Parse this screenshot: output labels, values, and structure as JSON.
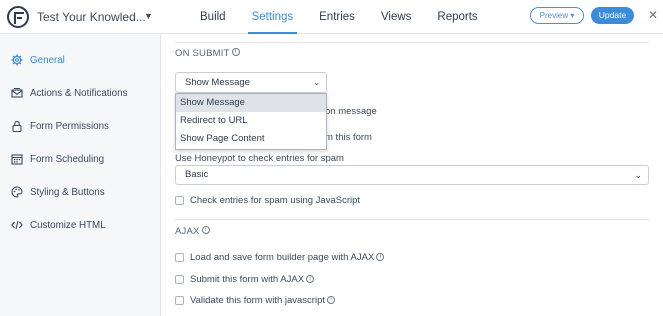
{
  "header": {
    "form_title": "Test Your Knowled...",
    "tabs": [
      {
        "label": "Build"
      },
      {
        "label": "Settings"
      },
      {
        "label": "Entries"
      },
      {
        "label": "Views"
      },
      {
        "label": "Reports"
      }
    ],
    "preview_label": "Preview ▾",
    "update_label": "Update",
    "close_glyph": "✕"
  },
  "sidebar": {
    "items": [
      {
        "label": "General",
        "icon": "gear-icon"
      },
      {
        "label": "Actions & Notifications",
        "icon": "envelope-icon"
      },
      {
        "label": "Form Permissions",
        "icon": "lock-icon"
      },
      {
        "label": "Form Scheduling",
        "icon": "calendar-icon"
      },
      {
        "label": "Styling & Buttons",
        "icon": "palette-icon"
      },
      {
        "label": "Customize HTML",
        "icon": "code-icon"
      }
    ]
  },
  "main": {
    "on_submit": {
      "title": "ON SUBMIT",
      "selected": "Show Message",
      "options": [
        "Show Message",
        "Redirect to URL",
        "Show Page Content"
      ]
    },
    "obscured_text": {
      "line1": "on message",
      "line2": "m this form"
    },
    "honeypot": {
      "label": "Use Honeypot to check entries for spam",
      "selected": "Basic"
    },
    "js_spam_check": {
      "label": "Check entries for spam using JavaScript",
      "checked": false
    },
    "ajax": {
      "title": "AJAX",
      "options": [
        {
          "label": "Load and save form builder page with AJAX",
          "checked": false
        },
        {
          "label": "Submit this form with AJAX",
          "checked": false
        },
        {
          "label": "Validate this form with javascript",
          "checked": false
        }
      ]
    }
  },
  "colors": {
    "accent": "#3b8cd9",
    "sidebar_bg": "#f5f7f9",
    "text": "#3a4a5e"
  }
}
